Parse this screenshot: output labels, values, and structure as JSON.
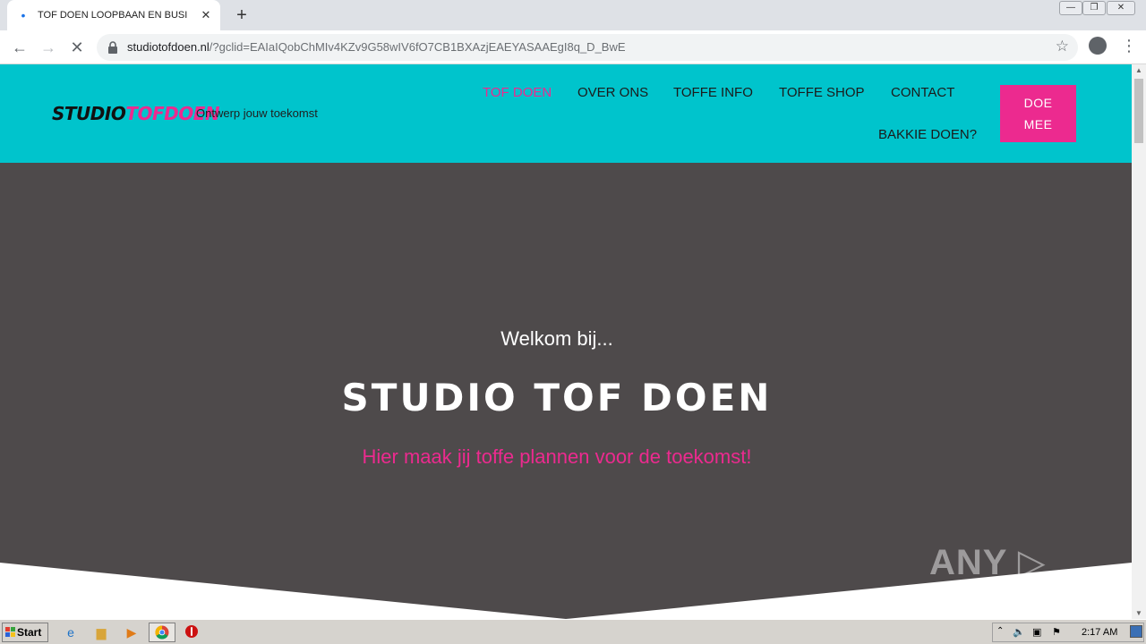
{
  "browser": {
    "tab_title": "TOF DOEN LOOPBAAN EN BUSINESS",
    "tab_close": "✕",
    "new_tab": "+",
    "url_host": "studiotofdoen.nl",
    "url_rest": "/?gclid=EAIaIQobChMIv4KZv9G58wIV6fO7CB1BXAzjEAEYASAAEgI8q_D_BwE",
    "back": "←",
    "forward": "→",
    "reload": "✕",
    "star": "☆",
    "menu": "⋮",
    "min": "—",
    "max": "❐",
    "close": "✕"
  },
  "site": {
    "logo_part1": "STUDIO",
    "logo_part2": "TOFDOEN",
    "tagline": "Ontwerp jouw toekomst",
    "nav": {
      "tof_doen": "TOF DOEN",
      "over_ons": "OVER ONS",
      "toffe_info": "TOFFE INFO",
      "toffe_shop": "TOFFE SHOP",
      "contact": "CONTACT",
      "bakkie_doen": "BAKKIE DOEN?"
    },
    "cta_line1": "DOE",
    "cta_line2": "MEE"
  },
  "hero": {
    "welcome": "Welkom bij...",
    "title": "STUDIO TOF DOEN",
    "tagline": "Hier maak jij toffe plannen voor de toekomst!"
  },
  "watermark": "ANY ▷ RUN",
  "taskbar": {
    "start": "Start",
    "clock": "2:17 AM"
  },
  "colors": {
    "teal": "#00c4cc",
    "pink": "#ec2a8f",
    "hero_bg": "#4e4a4b"
  }
}
